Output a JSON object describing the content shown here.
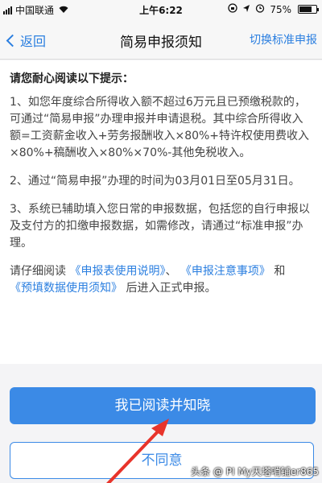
{
  "status_bar": {
    "carrier": "中国联通",
    "time": "上午6:22",
    "battery_percent": "75%",
    "battery_level": 0.75,
    "icons": [
      "signal-icon",
      "wifi-icon",
      "orientation-lock-icon",
      "location-icon",
      "alarm-icon",
      "battery-icon"
    ]
  },
  "nav": {
    "back_label": "返回",
    "title": "简易申报须知",
    "action_label": "切换标准申报"
  },
  "notice": {
    "heading": "请您耐心阅读以下提示：",
    "item1": "1、如您年度综合所得收入额不超过6万元且已预缴税款的，可通过“简易申报”办理申报并申请退税。其中综合所得收入额=工资薪金收入+劳务报酬收入×80%+特许权使用费收入×80%+稿酬收入×80%×70%-其他免税收入。",
    "item2": "2、通过“简易申报”办理的时间为03月01日至05月31日。",
    "item3": "3、系统已辅助填入您日常的申报数据，包括您的自行申报以及支付方的扣缴申报数据，如需修改，请通过“标准申报”办理。",
    "closing_prefix": "请仔细阅读",
    "link1": "《申报表使用说明》",
    "sep": "、",
    "link2": "《申报注意事项》",
    "and": "和",
    "link3": "《预填数据使用须知》",
    "closing_suffix": "后进入正式申报。"
  },
  "buttons": {
    "confirm": "我已阅读并知晓",
    "decline": "不同意"
  },
  "annotation": {
    "arrow_color": "#e8342b"
  },
  "watermark": {
    "text": "头条 @ PI My天塔哨铺er865"
  },
  "colors": {
    "accent": "#3b8ae6",
    "link": "#2b7fe0"
  }
}
